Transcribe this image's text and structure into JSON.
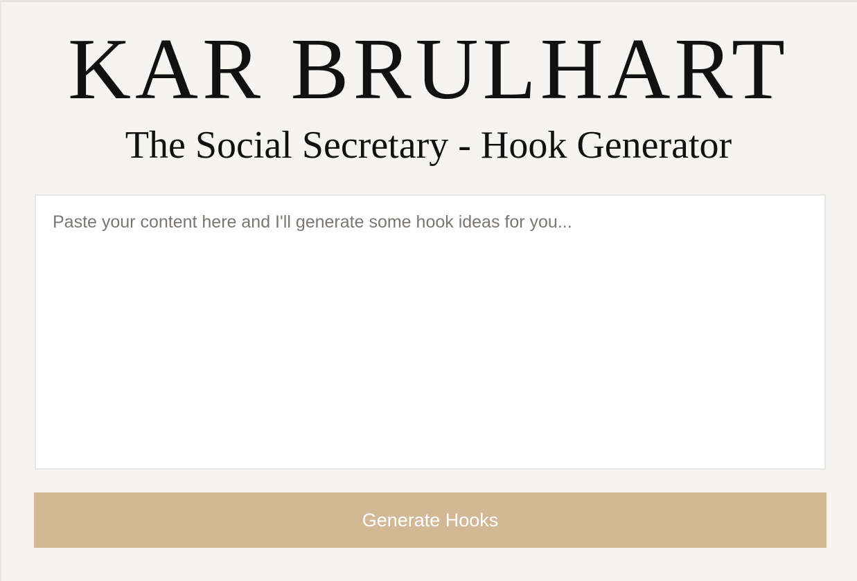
{
  "brand": {
    "name": "KAR BRULHART"
  },
  "page": {
    "subtitle": "The Social Secretary - Hook Generator"
  },
  "form": {
    "content_value": "",
    "content_placeholder": "Paste your content here and I'll generate some hook ideas for you...",
    "submit_label": "Generate Hooks"
  },
  "colors": {
    "background": "#f5f4f0",
    "button": "#d2b895",
    "button_text": "#ffffff",
    "heading_text": "#111111",
    "placeholder_text": "#7a7671"
  }
}
